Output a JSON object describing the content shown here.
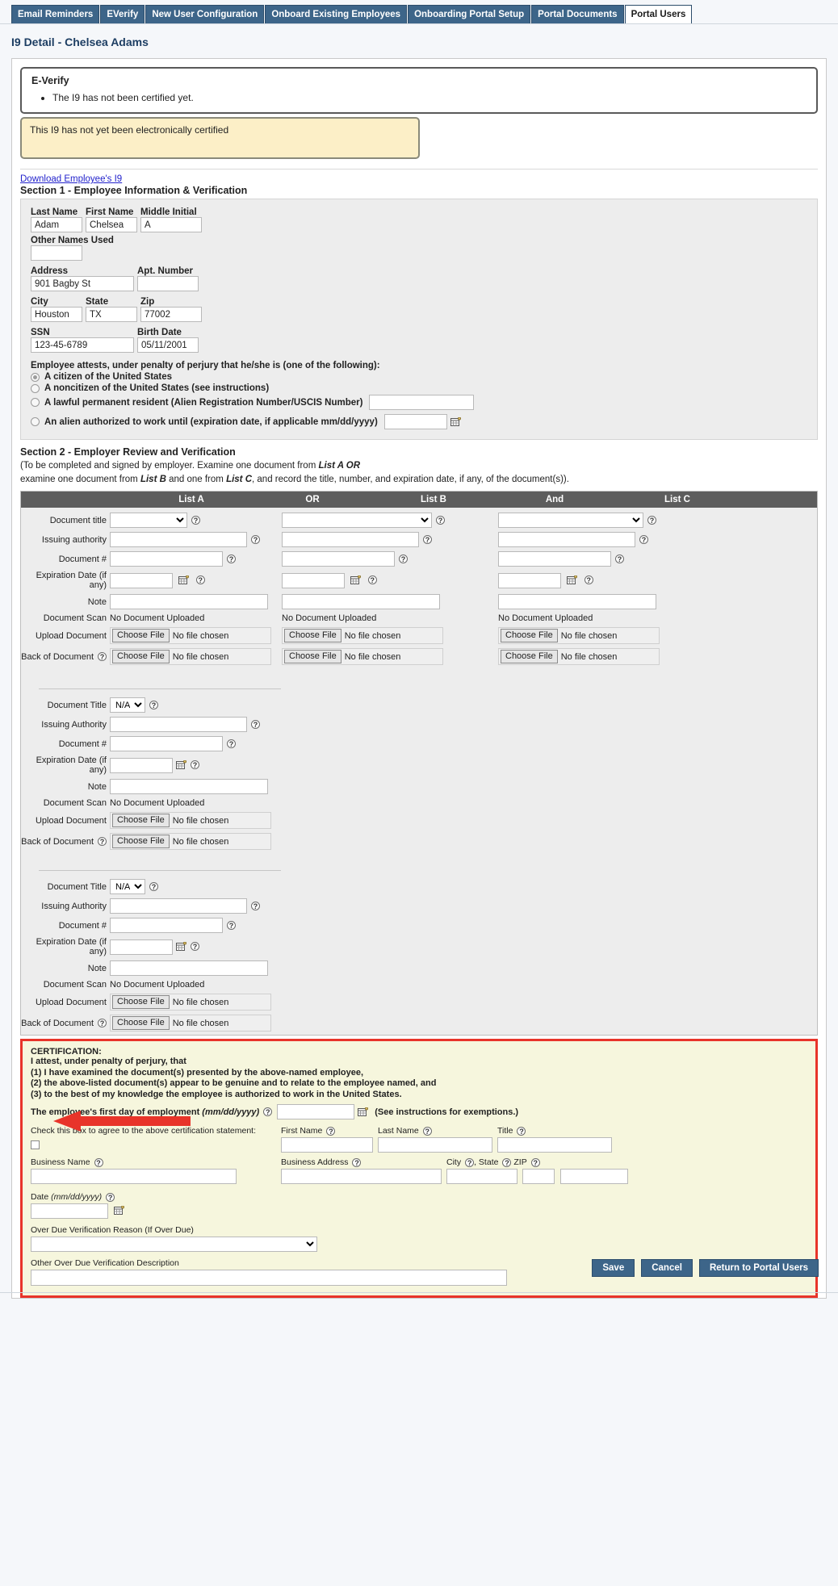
{
  "tabs": [
    {
      "label": "Email Reminders",
      "active": false
    },
    {
      "label": "EVerify",
      "active": false
    },
    {
      "label": "New User Configuration",
      "active": false
    },
    {
      "label": "Onboard Existing Employees",
      "active": false
    },
    {
      "label": "Onboarding Portal Setup",
      "active": false
    },
    {
      "label": "Portal Documents",
      "active": false
    },
    {
      "label": "Portal Users",
      "active": true
    }
  ],
  "page_title": "I9 Detail - Chelsea Adams",
  "everify": {
    "title": "E-Verify",
    "message": "The I9 has not been certified yet.",
    "not_certified_banner": "This I9 has not yet been electronically certified"
  },
  "download_link": "Download Employee's I9",
  "section1": {
    "heading": "Section 1 - Employee Information & Verification",
    "labels": {
      "last_name": "Last Name",
      "first_name": "First Name",
      "middle_initial": "Middle Initial",
      "other_names": "Other Names Used",
      "address": "Address",
      "apt": "Apt. Number",
      "city": "City",
      "state": "State",
      "zip": "Zip",
      "ssn": "SSN",
      "birth_date": "Birth Date"
    },
    "values": {
      "last_name": "Adam",
      "first_name": "Chelsea",
      "middle_initial": "A",
      "other_names": "",
      "address": "901 Bagby St",
      "apt": "",
      "city": "Houston",
      "state": "TX",
      "zip": "77002",
      "ssn": "123-45-6789",
      "birth_date": "05/11/2001"
    },
    "attest_title": "Employee attests, under penalty of perjury that he/she is (one of the following):",
    "attest_options": [
      {
        "label": "A citizen of the United States",
        "selected": true
      },
      {
        "label": "A noncitizen of the United States (see instructions)",
        "selected": false
      },
      {
        "label": "A lawful permanent resident (Alien Registration Number/USCIS Number)",
        "selected": false,
        "value": ""
      },
      {
        "label": "An alien authorized to work until (expiration date, if applicable mm/dd/yyyy)",
        "selected": false,
        "value": ""
      }
    ]
  },
  "section2": {
    "heading": "Section 2 - Employer Review and Verification",
    "note_line1_a": "(To be completed and signed by employer. Examine one document from ",
    "note_line1_b": "List A OR",
    "note_line2_a": "examine one document from ",
    "note_line2_b": "List B",
    "note_line2_c": " and one from ",
    "note_line2_d": "List C",
    "note_line2_e": ", and record the title, number, and expiration date, if any, of the document(s)).",
    "columns": [
      "List A",
      "OR",
      "List B",
      "And",
      "List C"
    ],
    "row_labels": {
      "document_title": "Document title",
      "issuing_authority": "Issuing authority",
      "document_number": "Document #",
      "expiration_date": "Expiration Date (if any)",
      "note": "Note",
      "document_scan": "Document Scan",
      "upload_document": "Upload Document",
      "back_of_document": "Back of Document"
    },
    "no_document_uploaded": "No Document Uploaded",
    "choose_file": "Choose File",
    "no_file_chosen": "No file chosen",
    "extra_blocks": [
      {
        "document_title_label": "Document Title",
        "document_title_value": "N/A",
        "issuing_authority_label": "Issuing Authority",
        "document_number_label": "Document #",
        "expiration_date_label": "Expiration Date (if any)",
        "note_label": "Note",
        "document_scan_label": "Document Scan",
        "upload_document_label": "Upload Document",
        "back_of_document_label": "Back of Document"
      },
      {
        "document_title_label": "Document Title",
        "document_title_value": "N/A",
        "issuing_authority_label": "Issuing Authority",
        "document_number_label": "Document #",
        "expiration_date_label": "Expiration Date (if any)",
        "note_label": "Note",
        "document_scan_label": "Document Scan",
        "upload_document_label": "Upload Document",
        "back_of_document_label": "Back of Document"
      }
    ]
  },
  "certification": {
    "heading": "CERTIFICATION:",
    "line1": "I attest, under penalty of perjury, that",
    "line2": "(1) I have examined the document(s) presented by the above-named employee,",
    "line3": "(2) the above-listed document(s) appear to be genuine and to relate to the employee named, and",
    "line4": "(3) to the best of my knowledge the employee is authorized to work in the United States.",
    "first_day_label": "The employee's first day of employment",
    "first_day_format": "(mm/dd/yyyy)",
    "first_day_value": "",
    "exemptions_note": "(See instructions for exemptions.)",
    "checkbox_label": "Check this box to agree to the above certification statement:",
    "checkbox_checked": false,
    "first_name_label": "First Name",
    "first_name_value": "",
    "last_name_label": "Last Name",
    "last_name_value": "",
    "title_label": "Title",
    "title_value": "",
    "business_name_label": "Business Name",
    "business_name_value": "",
    "business_address_label": "Business Address",
    "business_address_value": "",
    "city_label": "City",
    "city_value": "",
    "state_label": ", State",
    "state_value": "",
    "zip_label": "ZIP",
    "zip_value": "",
    "date_label": "Date",
    "date_format": "(mm/dd/yyyy)",
    "date_value": "",
    "overdue_reason_label": "Over Due Verification Reason (If Over Due)",
    "overdue_reason_value": "",
    "overdue_desc_label": "Other Over Due Verification Description",
    "overdue_desc_value": ""
  },
  "footer": {
    "save": "Save",
    "cancel": "Cancel",
    "return": "Return to Portal Users"
  },
  "colors": {
    "tab_blue": "#3d6589",
    "banner_yellow": "#fcefc7",
    "cert_red": "#e8342a",
    "cert_yellow": "#f6f6dd",
    "header_gray": "#5d5d5d"
  }
}
